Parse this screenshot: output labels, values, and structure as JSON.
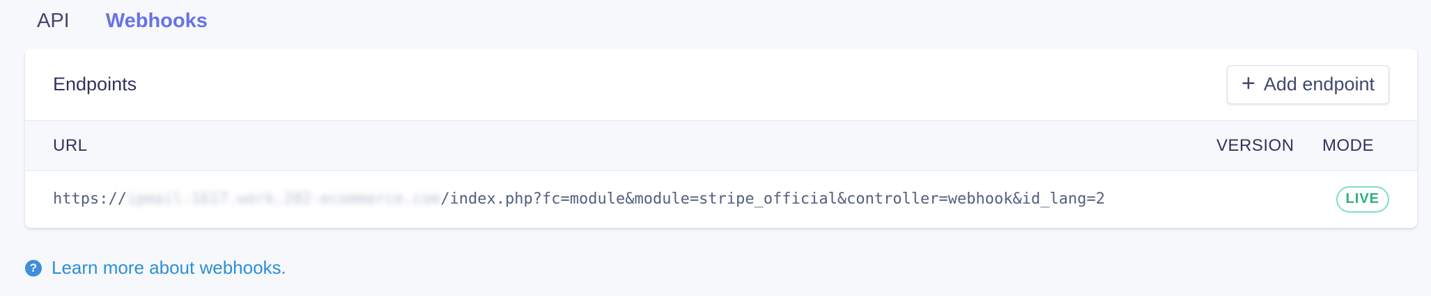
{
  "tabs": [
    {
      "label": "API",
      "active": false
    },
    {
      "label": "Webhooks",
      "active": true
    }
  ],
  "card": {
    "title": "Endpoints",
    "add_button_label": "Add endpoint",
    "add_button_icon": "plus-icon"
  },
  "table": {
    "headers": {
      "url": "URL",
      "version": "VERSION",
      "mode": "MODE"
    },
    "rows": [
      {
        "url_prefix": "https://",
        "url_host_redacted": "ipmail-1617.work.202-ecommerce.com",
        "url_path": "/index.php?fc=module&module=stripe_official&controller=webhook&id_lang=2",
        "version": "",
        "mode": "LIVE"
      }
    ]
  },
  "footer": {
    "help_icon": "question-circle-icon",
    "learn_more": "Learn more about webhooks."
  },
  "colors": {
    "accent": "#6772e5",
    "link": "#2d8fd5",
    "live_green": "#2bb07a",
    "background": "#f6f8fb"
  }
}
